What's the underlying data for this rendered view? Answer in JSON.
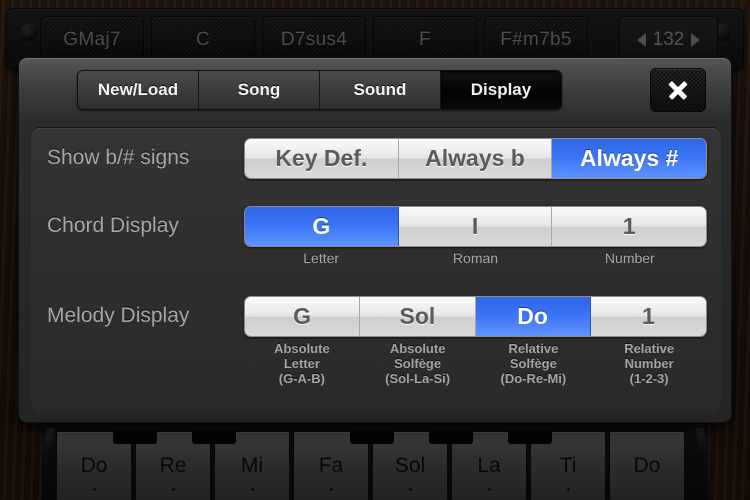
{
  "chord_bar": {
    "chords": [
      "GMaj7",
      "C",
      "D7sus4",
      "F",
      "F#m7b5"
    ],
    "tempo": {
      "value": "132",
      "prev_icon": "triangle-left-icon",
      "next_icon": "triangle-right-icon"
    }
  },
  "modal": {
    "tabs": [
      {
        "label": "New/Load",
        "active": false
      },
      {
        "label": "Song",
        "active": false
      },
      {
        "label": "Sound",
        "active": false
      },
      {
        "label": "Display",
        "active": true
      }
    ],
    "close_icon": "close-icon",
    "rows": [
      {
        "label": "Show b/# signs",
        "options": [
          {
            "label": "Key Def.",
            "selected": false
          },
          {
            "label": "Always b",
            "selected": false
          },
          {
            "label": "Always #",
            "selected": true
          }
        ],
        "sublabels": []
      },
      {
        "label": "Chord Display",
        "options": [
          {
            "label": "G",
            "selected": true
          },
          {
            "label": "I",
            "selected": false
          },
          {
            "label": "1",
            "selected": false
          }
        ],
        "sublabels": [
          [
            "Letter"
          ],
          [
            "Roman"
          ],
          [
            "Number"
          ]
        ]
      },
      {
        "label": "Melody Display",
        "options": [
          {
            "label": "G",
            "selected": false
          },
          {
            "label": "Sol",
            "selected": false
          },
          {
            "label": "Do",
            "selected": true
          },
          {
            "label": "1",
            "selected": false
          }
        ],
        "sublabels": [
          [
            "Absolute",
            "Letter",
            "(G-A-B)"
          ],
          [
            "Absolute",
            "Solfège",
            "(Sol-La-Si)"
          ],
          [
            "Relative",
            "Solfège",
            "(Do-Re-Mi)"
          ],
          [
            "Relative",
            "Number",
            "(1-2-3)"
          ]
        ]
      }
    ]
  },
  "keyboard": {
    "keys": [
      {
        "label": "Do",
        "dot": true
      },
      {
        "label": "Re",
        "dot": true
      },
      {
        "label": "Mi",
        "dot": true
      },
      {
        "label": "Fa",
        "dot": true
      },
      {
        "label": "Sol",
        "dot": true
      },
      {
        "label": "La",
        "dot": true
      },
      {
        "label": "Ti",
        "dot": true
      },
      {
        "label": "Do",
        "dot": false
      }
    ]
  },
  "colors": {
    "accent_blue": "#3a74f4",
    "panel_dark": "#2e2e2e",
    "tab_active": "#050505",
    "label_gray": "#a6a6a6"
  }
}
